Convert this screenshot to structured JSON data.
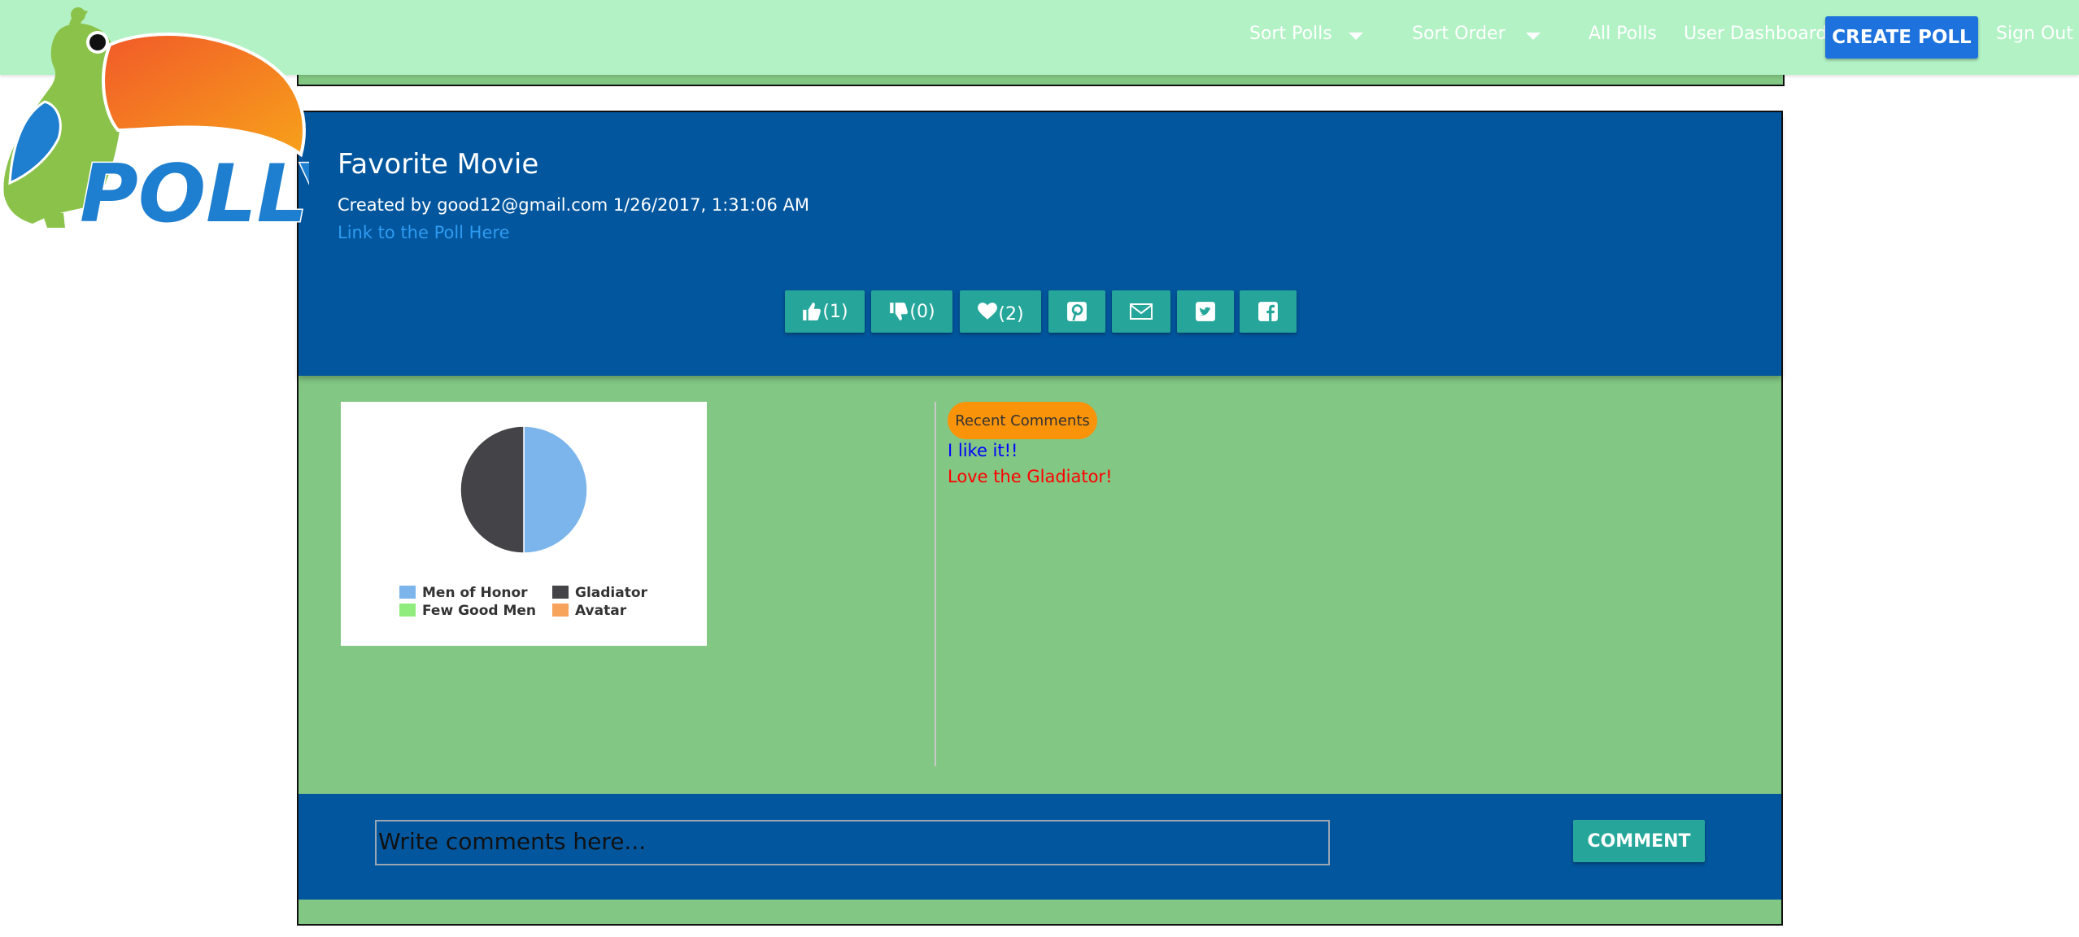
{
  "nav": {
    "sort_polls": "Sort Polls",
    "sort_order": "Sort Order",
    "all_polls": "All Polls",
    "user_dashboard": "User Dashboard",
    "create_poll": "CREATE POLL",
    "sign_out": "Sign Out"
  },
  "logo": {
    "text": "POLLY"
  },
  "poll": {
    "title": "Favorite Movie",
    "created": "Created by good12@gmail.com 1/26/2017, 1:31:06 AM",
    "link_text": "Link to the Poll Here"
  },
  "actions": {
    "like": "(1)",
    "dislike": "(0)",
    "favorite": "(2)"
  },
  "icons": [
    "thumbs-up-icon",
    "thumbs-down-icon",
    "heart-icon",
    "pinterest-icon",
    "envelope-icon",
    "twitter-icon",
    "facebook-icon"
  ],
  "chart_data": {
    "type": "pie",
    "categories": [
      "Men of Honor",
      "Gladiator",
      "Few Good Men",
      "Avatar"
    ],
    "values": [
      1,
      1,
      0,
      0
    ],
    "colors": [
      "#7cb5ec",
      "#434348",
      "#90ed7d",
      "#f7a35c"
    ],
    "legend": "bottom"
  },
  "comments": {
    "header": "Recent Comments",
    "items": [
      {
        "text": "I like it!!",
        "color": "#0000ff"
      },
      {
        "text": "Love the Gladiator!",
        "color": "#ff0000"
      }
    ]
  },
  "comment_form": {
    "placeholder": "Write comments here...",
    "button": "COMMENT"
  },
  "colors": {
    "navbar": "#b2f2c4",
    "primary_blue": "#02569e",
    "card_green": "#82c783",
    "teal_button": "#26a69a",
    "create_button": "#1e72dd",
    "badge_orange": "#f8930a"
  }
}
